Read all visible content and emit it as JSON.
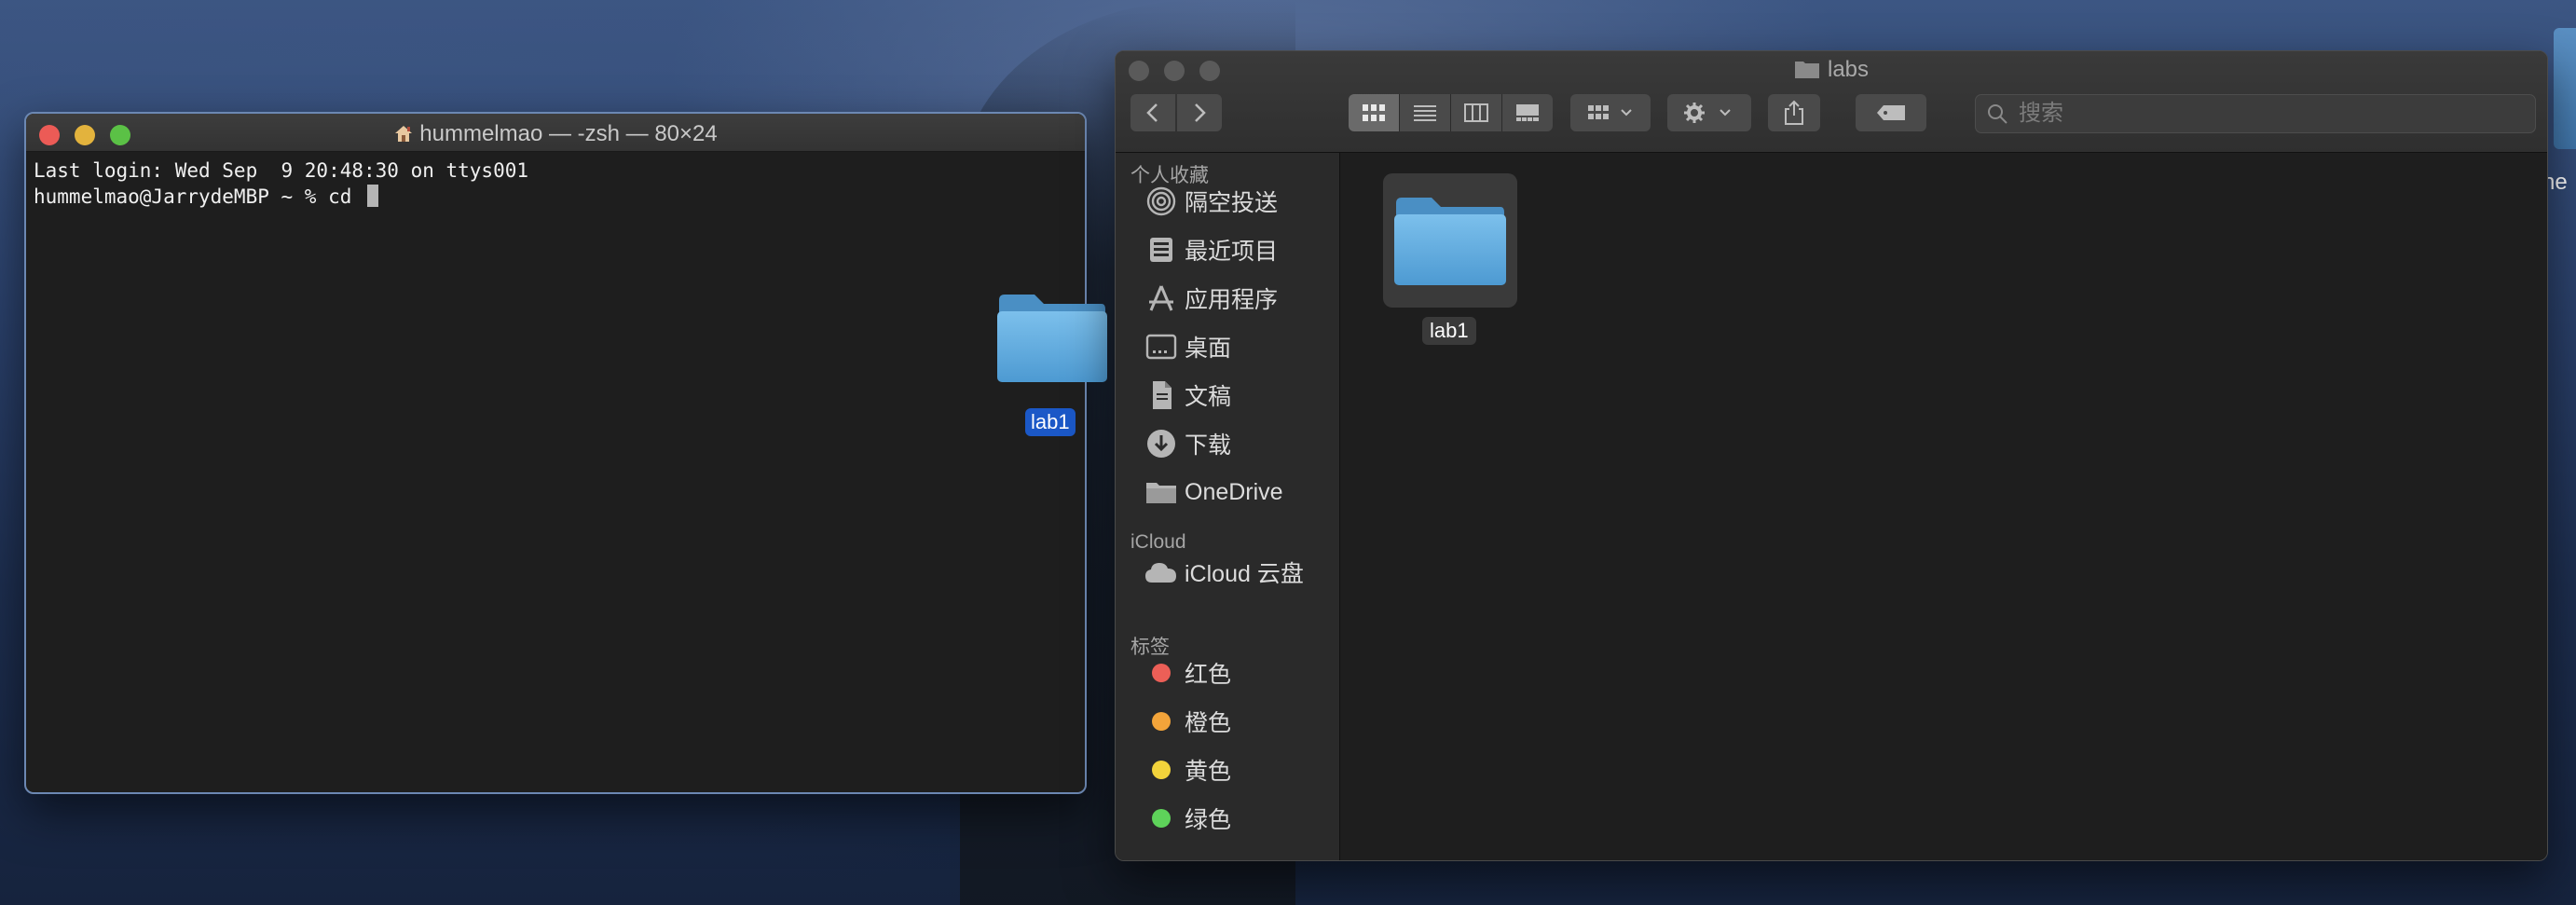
{
  "terminal": {
    "title": "hummelmao — -zsh — 80×24",
    "lines": [
      "Last login: Wed Sep  9 20:48:30 on ttys001",
      "hummelmao@JarrydeMBP ~ % cd "
    ]
  },
  "drag": {
    "label": "lab1",
    "icon": "folder-icon"
  },
  "finder": {
    "title": "labs",
    "search_placeholder": "搜索",
    "sidebar": {
      "favorites_header": "个人收藏",
      "favorites": [
        {
          "label": "隔空投送",
          "icon": "airdrop-icon"
        },
        {
          "label": "最近项目",
          "icon": "recents-icon"
        },
        {
          "label": "应用程序",
          "icon": "applications-icon"
        },
        {
          "label": "桌面",
          "icon": "desktop-icon"
        },
        {
          "label": "文稿",
          "icon": "documents-icon"
        },
        {
          "label": "下载",
          "icon": "downloads-icon"
        },
        {
          "label": "OneDrive",
          "icon": "folder-icon"
        }
      ],
      "icloud_header": "iCloud",
      "icloud": [
        {
          "label": "iCloud 云盘",
          "icon": "cloud-icon"
        }
      ],
      "tags_header": "标签",
      "tags": [
        {
          "label": "红色",
          "color": "#ec5f57"
        },
        {
          "label": "橙色",
          "color": "#f3a43a"
        },
        {
          "label": "黄色",
          "color": "#f2d33b"
        },
        {
          "label": "绿色",
          "color": "#5ed35a"
        }
      ]
    },
    "files": [
      {
        "name": "lab1",
        "icon": "folder-icon"
      }
    ]
  },
  "edge_fragment": "he"
}
